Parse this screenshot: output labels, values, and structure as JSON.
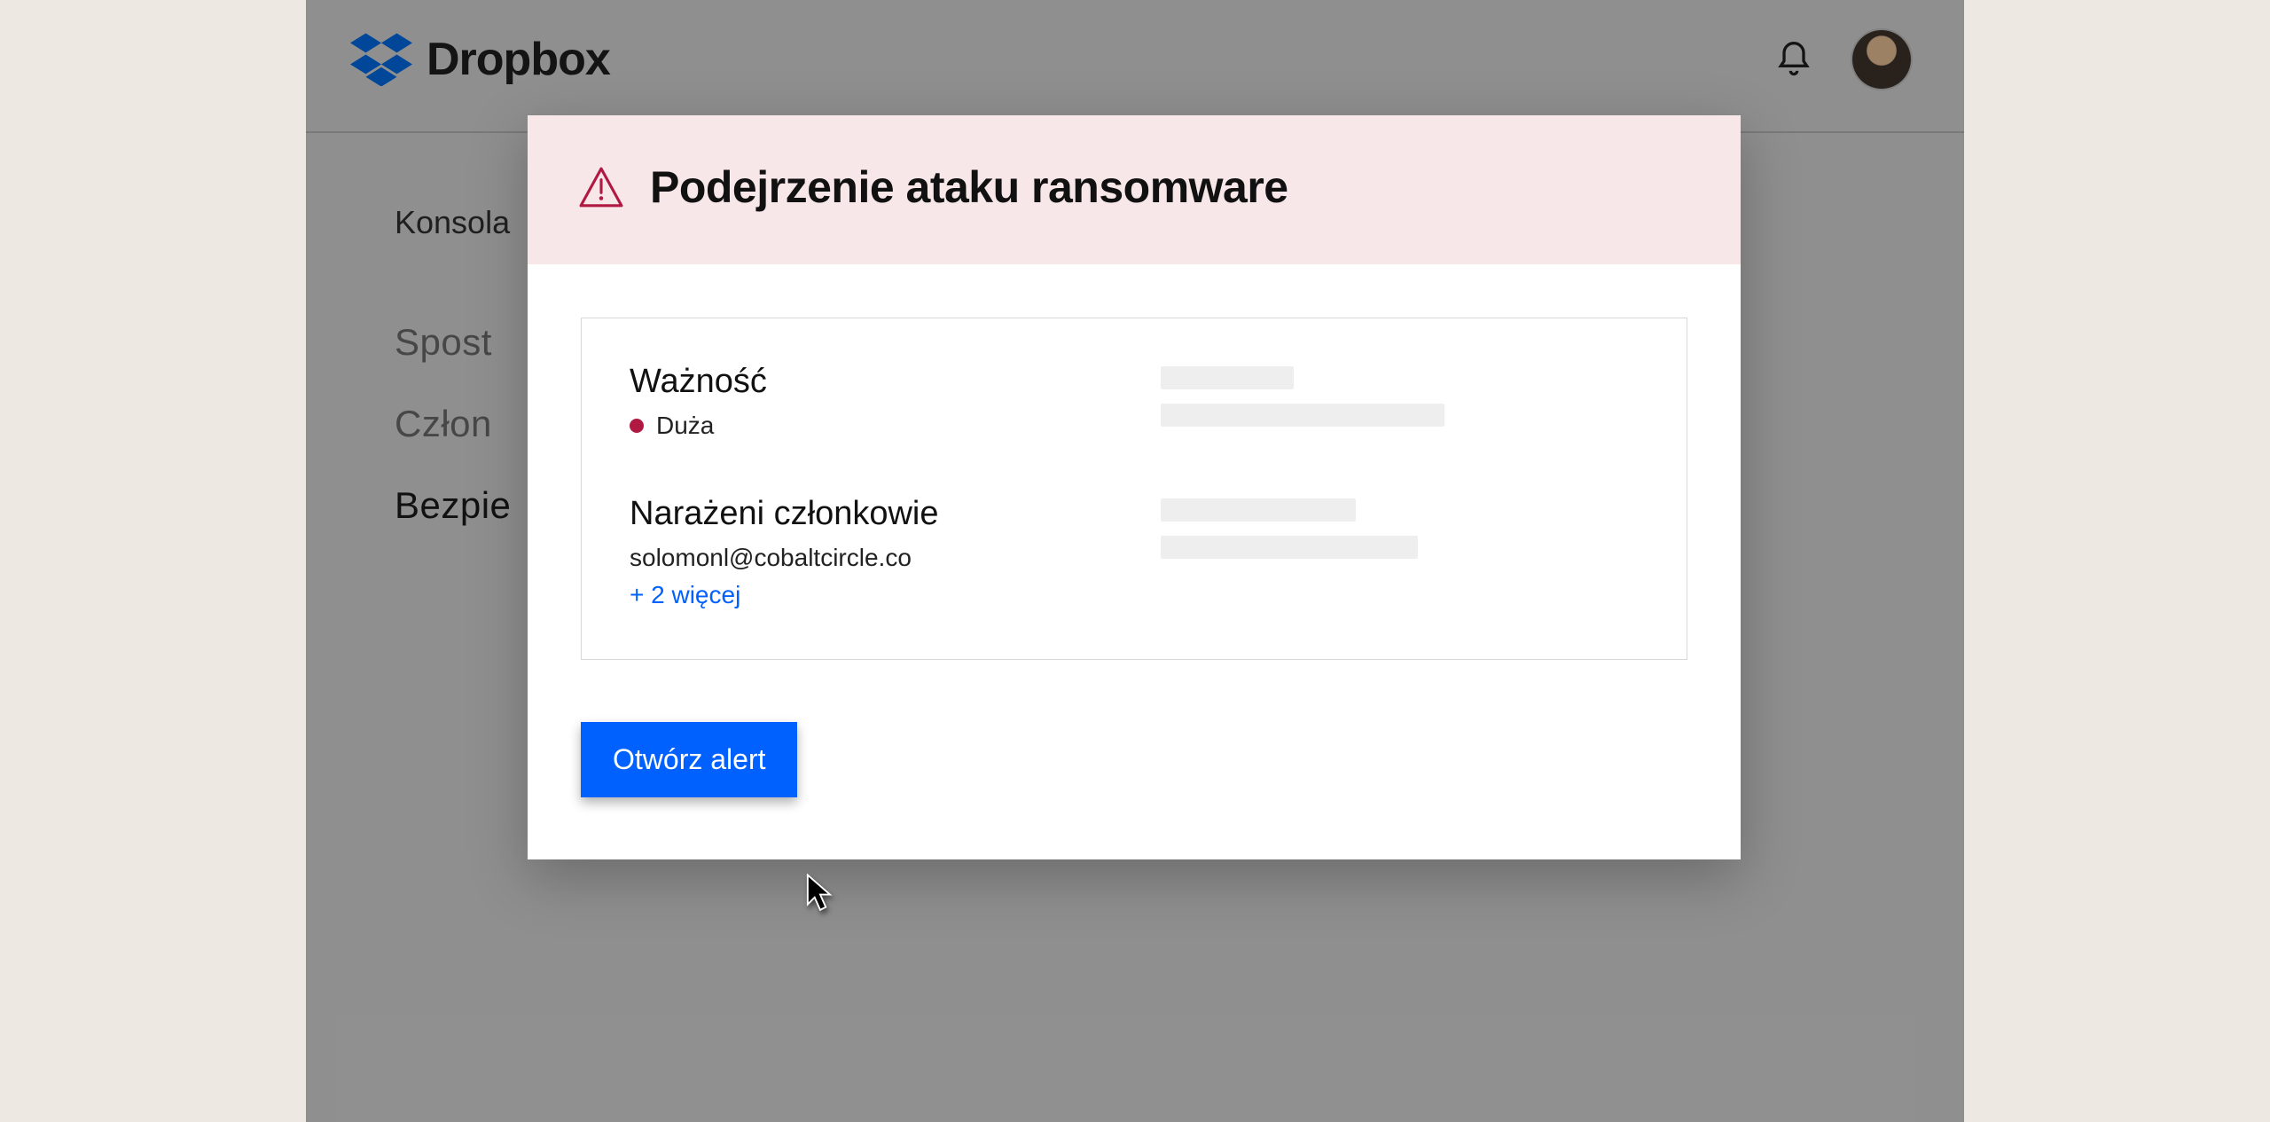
{
  "brand": {
    "name": "Dropbox"
  },
  "breadcrumb": "Konsola ",
  "sidebar": {
    "items": [
      {
        "label": "Spost"
      },
      {
        "label": "Człon"
      },
      {
        "label": "Bezpie"
      }
    ],
    "active_index": 2
  },
  "modal": {
    "title": "Podejrzenie ataku ransomware",
    "severity": {
      "label": "Ważność",
      "value": "Duża"
    },
    "members": {
      "label": "Narażeni członkowie",
      "email": "solomonl@cobaltcircle.co",
      "more": "+ 2 więcej"
    },
    "open_alert": "Otwórz alert"
  }
}
